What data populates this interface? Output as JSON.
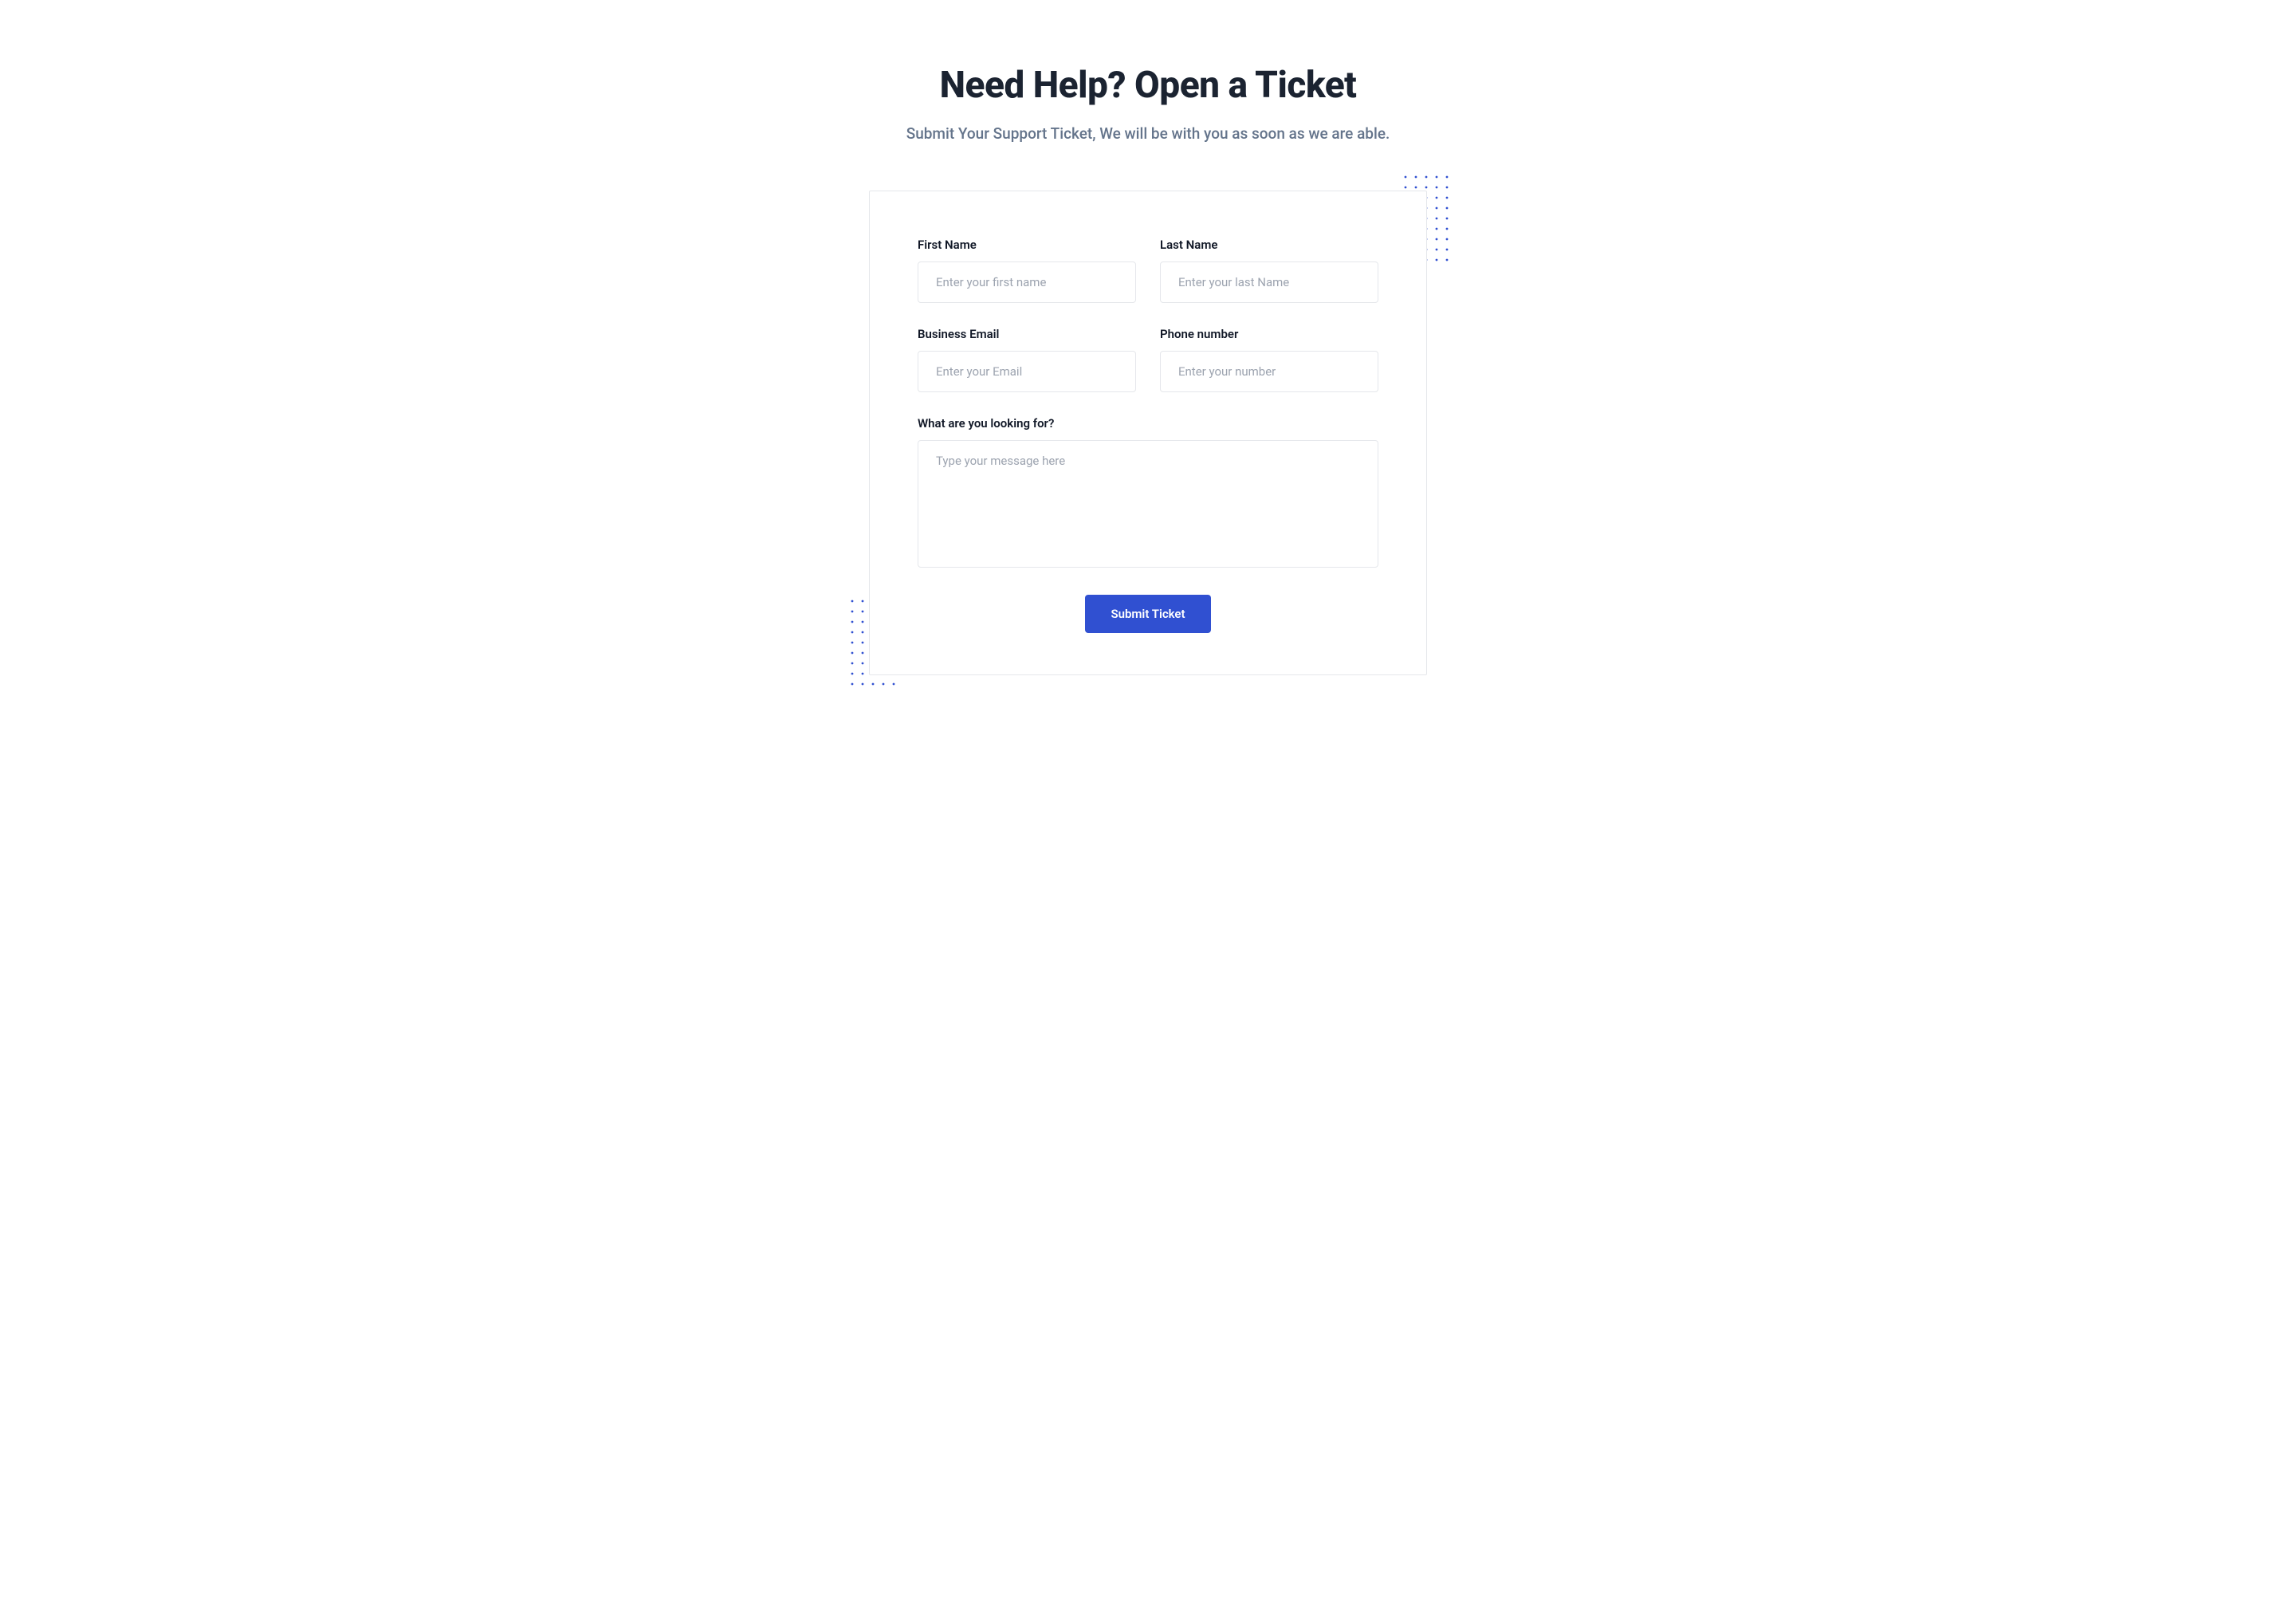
{
  "header": {
    "title": "Need Help? Open a Ticket",
    "subtitle": "Submit Your Support Ticket, We will be with you as soon as we are able."
  },
  "form": {
    "first_name": {
      "label": "First Name",
      "placeholder": "Enter your first name"
    },
    "last_name": {
      "label": "Last Name",
      "placeholder": "Enter your last Name"
    },
    "email": {
      "label": "Business Email",
      "placeholder": "Enter your Email"
    },
    "phone": {
      "label": "Phone number",
      "placeholder": "Enter your number"
    },
    "message": {
      "label": "What are you looking for?",
      "placeholder": "Type your message here"
    },
    "submit_label": "Submit Ticket"
  },
  "colors": {
    "primary": "#3050d1",
    "heading": "#1b2331",
    "muted": "#64748b",
    "border": "#e5e7eb",
    "placeholder": "#9ca3af"
  }
}
